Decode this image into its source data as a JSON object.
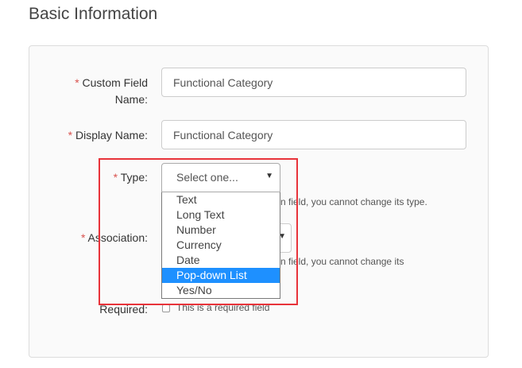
{
  "section_title": "Basic Information",
  "form": {
    "custom_field_name": {
      "required_mark": "*",
      "label_line1": "Custom Field",
      "label_line2": "Name:",
      "value": "Functional Category"
    },
    "display_name": {
      "required_mark": "*",
      "label": "Display Name:",
      "value": "Functional Category"
    },
    "type": {
      "required_mark": "*",
      "label": "Type:",
      "selected": "Select one...",
      "help_visible": "n field, you cannot change its type.",
      "options": [
        "Text",
        "Long Text",
        "Number",
        "Currency",
        "Date",
        "Pop-down List",
        "Yes/No"
      ],
      "highlighted_option": "Pop-down List"
    },
    "association": {
      "required_mark": "*",
      "label": "Association:",
      "help_visible": "n field, you cannot change its"
    },
    "required": {
      "label": "Required:",
      "checkbox_label": "This is a required field",
      "checked": false
    }
  },
  "colors": {
    "required_star": "#d9534f",
    "highlight_border": "#e8333a",
    "selected_option_bg": "#1e90ff"
  },
  "icons": {
    "select_caret": "▼"
  }
}
